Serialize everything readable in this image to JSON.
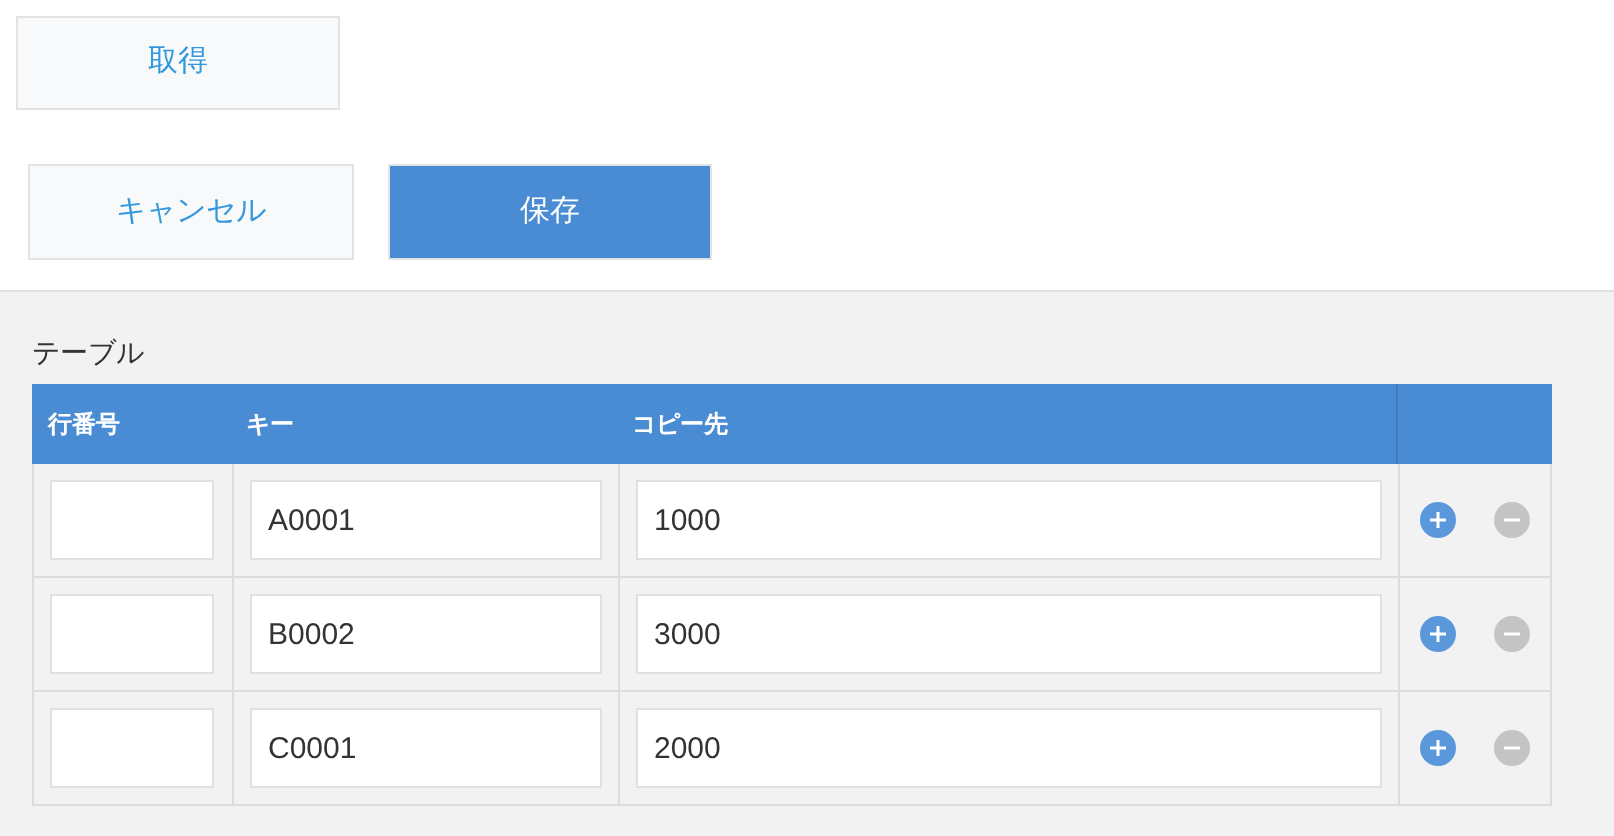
{
  "fetch_button": {
    "label": "取得"
  },
  "cancel_button": {
    "label": "キャンセル"
  },
  "save_button": {
    "label": "保存"
  },
  "table": {
    "title": "テーブル",
    "columns": [
      "行番号",
      "キー",
      "コピー先"
    ],
    "rows": [
      {
        "row_number": "",
        "key": "A0001",
        "destination": "1000",
        "remove_disabled": true
      },
      {
        "row_number": "",
        "key": "B0002",
        "destination": "3000",
        "remove_disabled": true
      },
      {
        "row_number": "",
        "key": "C0001",
        "destination": "2000",
        "remove_disabled": true
      }
    ]
  }
}
